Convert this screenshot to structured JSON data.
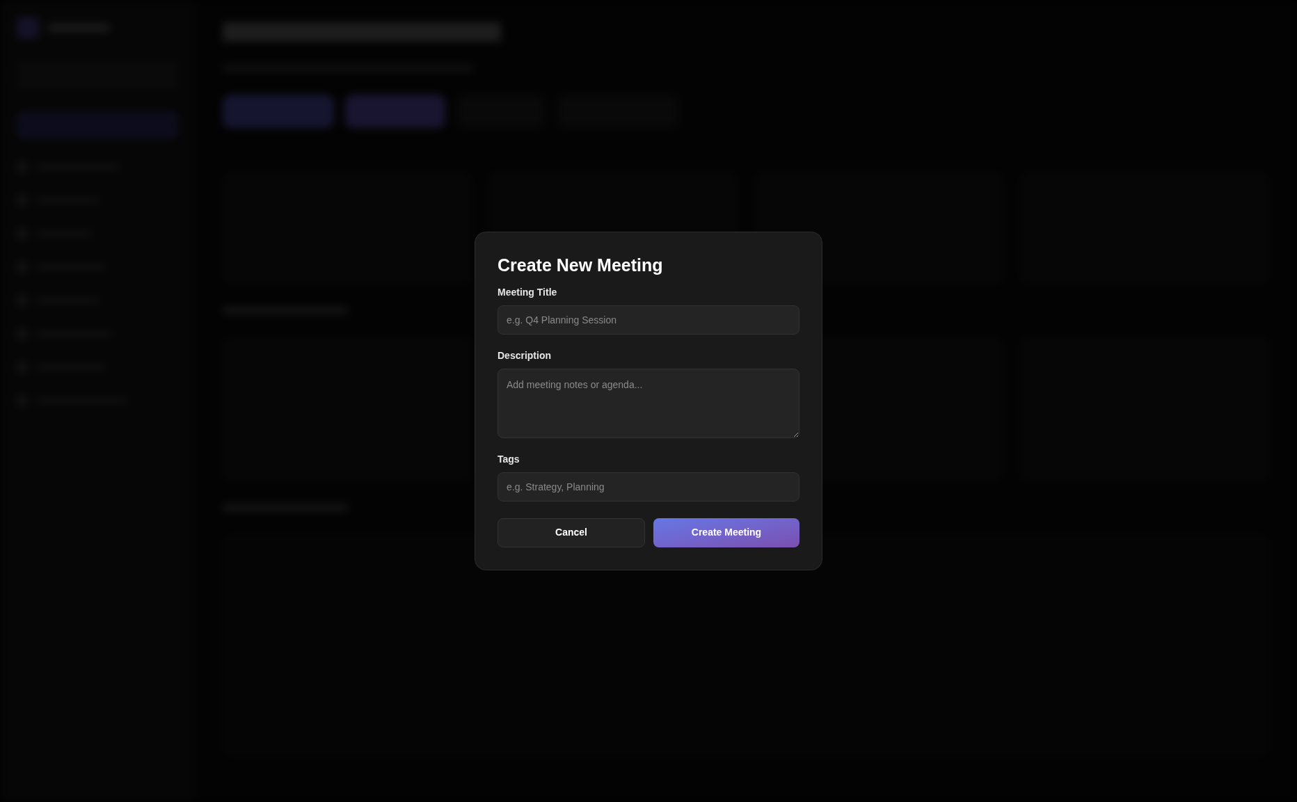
{
  "dialog": {
    "title": "Create New Meeting",
    "fields": [
      {
        "kind": "input",
        "label": "Meeting Title",
        "placeholder": "e.g. Q4 Planning Session"
      },
      {
        "kind": "textarea",
        "label": "Description",
        "placeholder": "Add meeting notes or agenda..."
      },
      {
        "kind": "input",
        "label": "Tags",
        "placeholder": "e.g. Strategy, Planning"
      }
    ],
    "buttons": [
      {
        "kind": "secondary",
        "label": "Cancel"
      },
      {
        "kind": "primary",
        "label": "Create Meeting"
      }
    ]
  }
}
